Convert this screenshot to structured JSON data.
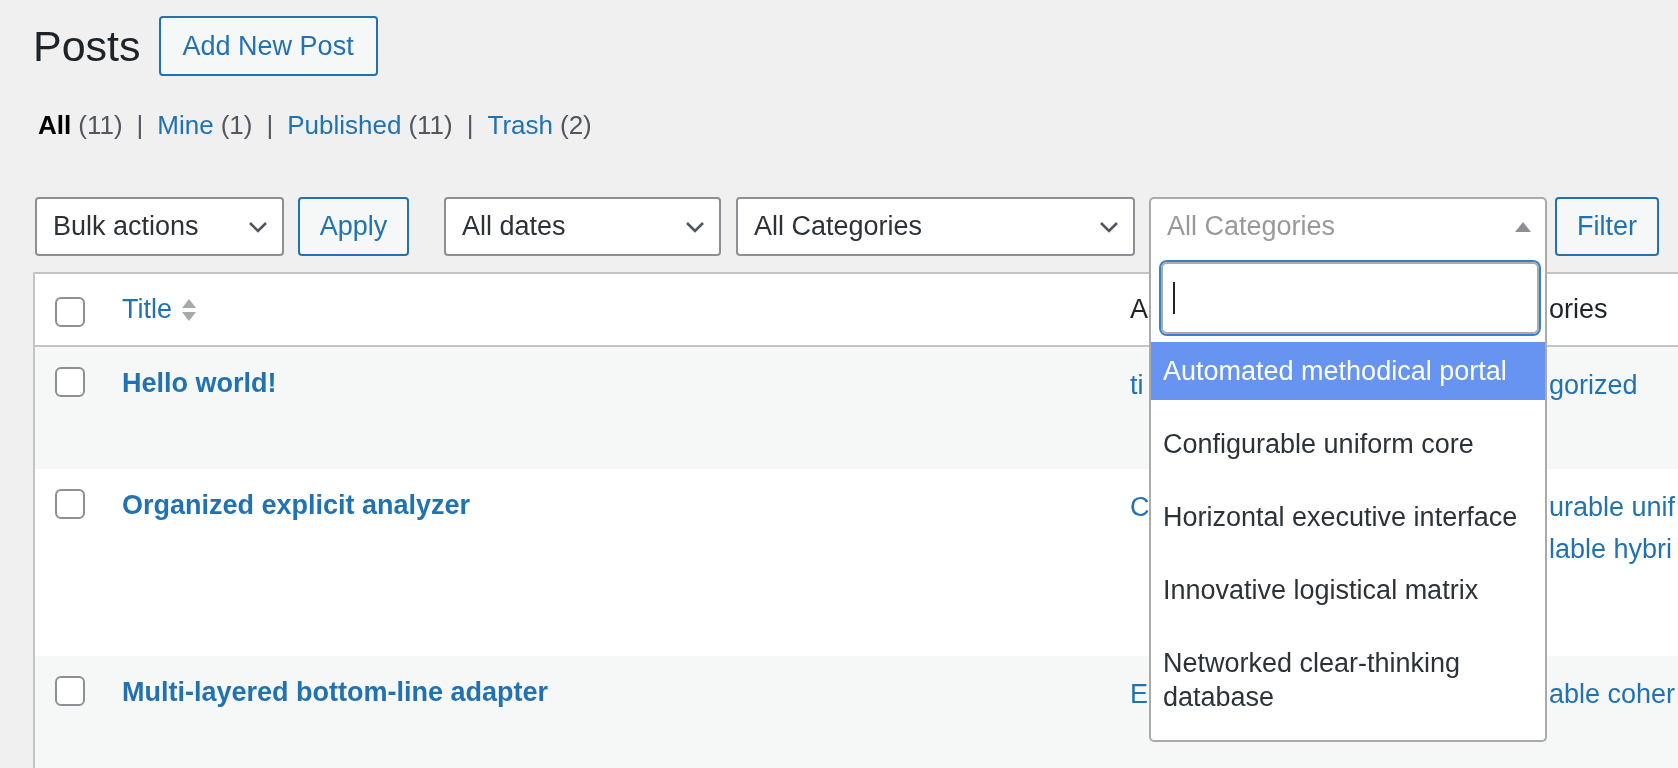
{
  "page": {
    "title": "Posts",
    "add_button": "Add New Post"
  },
  "views": [
    {
      "label": "All",
      "count": "(11)",
      "selected": true
    },
    {
      "separator": "|",
      "label": "Mine",
      "count": "(1)",
      "selected": false
    },
    {
      "separator": "|",
      "label": "Published",
      "count": "(11)",
      "selected": false
    },
    {
      "separator": "|",
      "label": "Trash",
      "count": "(2)",
      "selected": false
    }
  ],
  "toolbar": {
    "bulk_actions": "Bulk actions",
    "apply": "Apply",
    "date_filter": "All dates",
    "category_filter": "All Categories",
    "category_combo": {
      "placeholder": "All Categories",
      "expanded": true,
      "options": [
        {
          "label": "Automated methodical portal",
          "selected": true
        },
        {
          "label": "Configurable uniform core",
          "selected": false
        },
        {
          "label": "Horizontal executive interface",
          "selected": false
        },
        {
          "label": "Innovative logistical matrix",
          "selected": false
        },
        {
          "label": "Networked clear-thinking database",
          "selected": false
        }
      ]
    },
    "filter": "Filter"
  },
  "table": {
    "select_all_checked": false,
    "columns": [
      {
        "label": "Title",
        "sortable": true
      },
      {
        "label": "A",
        "sortable": false
      },
      {
        "label": "ories",
        "sortable": false
      }
    ],
    "rows": [
      {
        "checked": false,
        "title": "Hello world!",
        "author": "ti",
        "categories": [
          "gorized"
        ]
      },
      {
        "checked": false,
        "title": "Organized explicit analyzer",
        "author": "C",
        "categories": [
          "urable unif",
          "lable hybri"
        ]
      },
      {
        "checked": false,
        "title": "Multi-layered bottom-line adapter",
        "author": "E",
        "categories": [
          "able coher"
        ]
      }
    ]
  }
}
